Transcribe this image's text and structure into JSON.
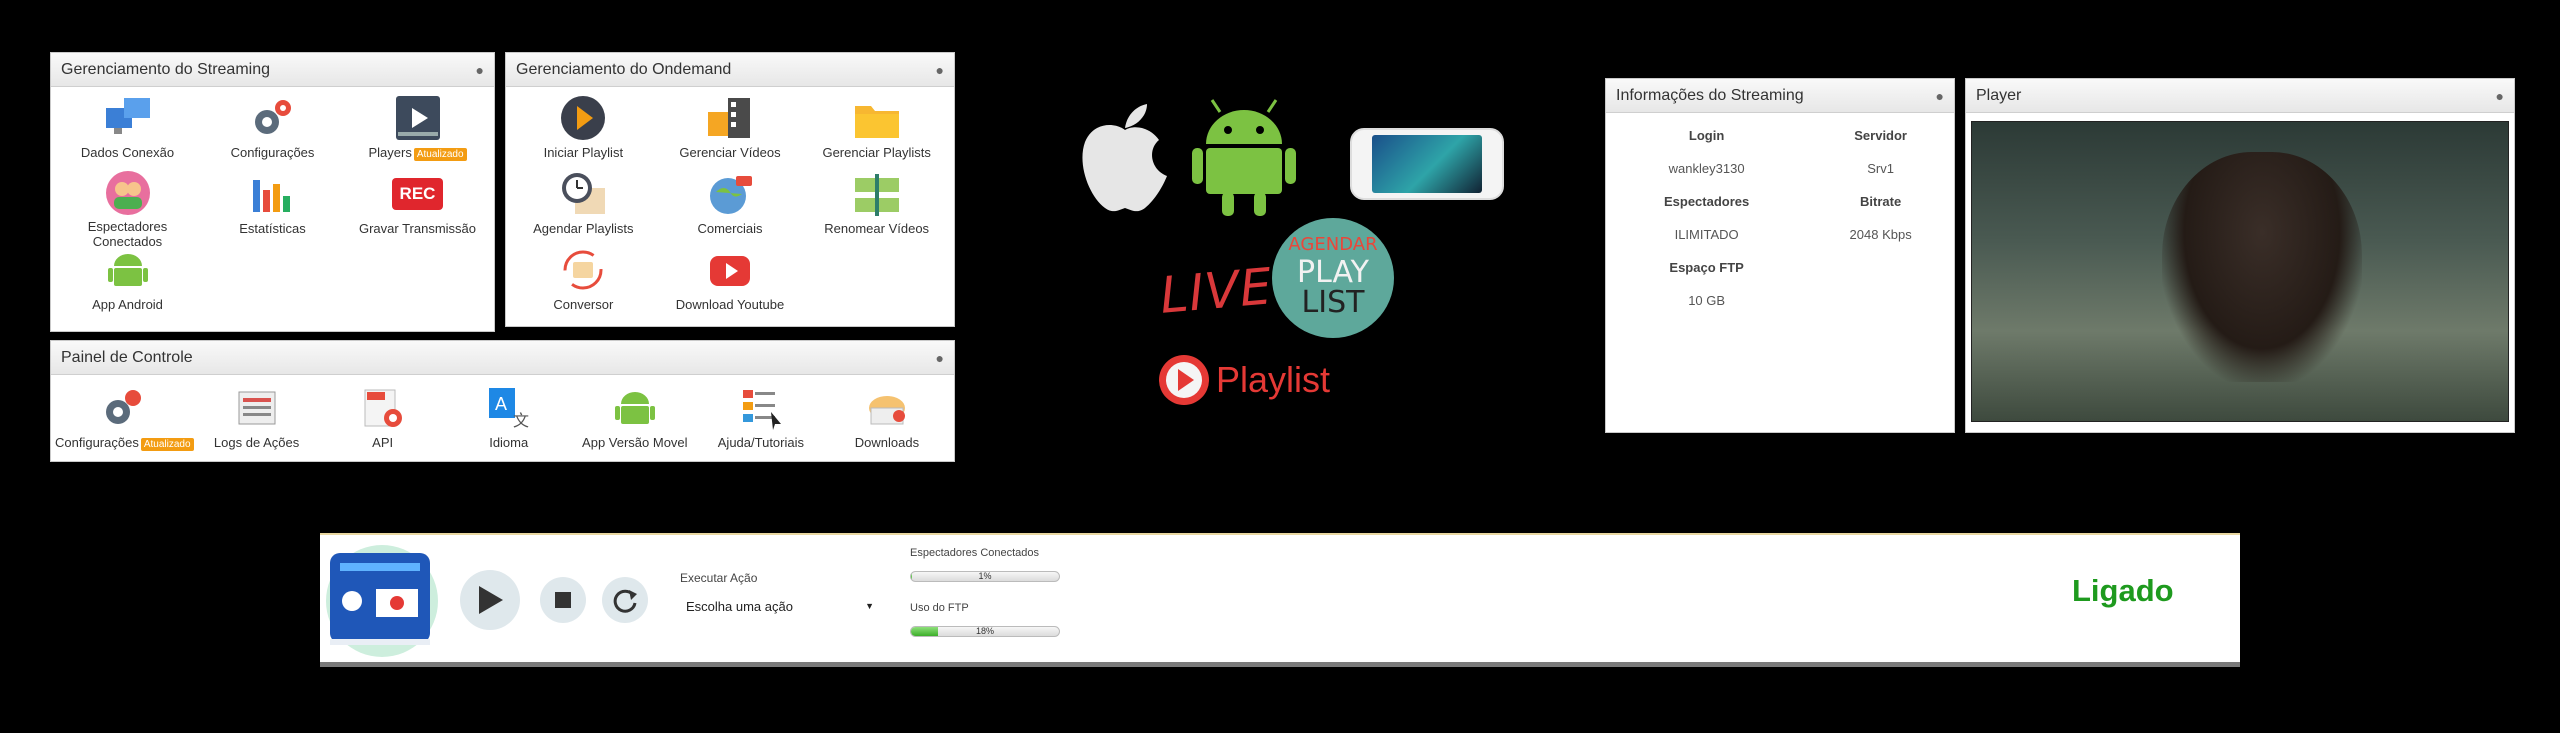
{
  "streaming": {
    "title": "Gerenciamento do Streaming",
    "items": [
      {
        "label": "Dados Conexão"
      },
      {
        "label": "Configurações"
      },
      {
        "label": "Players",
        "badge": "Atualizado"
      },
      {
        "label": "Espectadores Conectados"
      },
      {
        "label": "Estatísticas"
      },
      {
        "label": "Gravar Transmissão"
      },
      {
        "label": "App Android"
      }
    ]
  },
  "ondemand": {
    "title": "Gerenciamento do Ondemand",
    "items": [
      {
        "label": "Iniciar Playlist"
      },
      {
        "label": "Gerenciar Vídeos"
      },
      {
        "label": "Gerenciar Playlists"
      },
      {
        "label": "Agendar Playlists"
      },
      {
        "label": "Comerciais"
      },
      {
        "label": "Renomear Vídeos"
      },
      {
        "label": "Conversor"
      },
      {
        "label": "Download Youtube"
      }
    ]
  },
  "painel": {
    "title": "Painel de Controle",
    "items": [
      {
        "label": "Configurações",
        "badge": "Atualizado"
      },
      {
        "label": "Logs de Ações"
      },
      {
        "label": "API"
      },
      {
        "label": "Idioma"
      },
      {
        "label": "App Versão Movel"
      },
      {
        "label": "Ajuda/Tutoriais"
      },
      {
        "label": "Downloads"
      }
    ]
  },
  "promo": {
    "live": "LIVE",
    "agendar": "AGENDAR",
    "play": "PLAY",
    "list": "LIST",
    "playlist": "Playlist",
    "rec": "REC"
  },
  "info": {
    "title": "Informações do Streaming",
    "login_label": "Login",
    "login": "wankley3130",
    "servidor_label": "Servidor",
    "servidor": "Srv1",
    "espectadores_label": "Espectadores",
    "espectadores": "ILIMITADO",
    "bitrate_label": "Bitrate",
    "bitrate": "2048 Kbps",
    "ftp_label": "Espaço FTP",
    "ftp": "10 GB"
  },
  "player": {
    "title": "Player"
  },
  "control": {
    "action_label": "Executar Ação",
    "action_value": "Escolha uma ação",
    "viewers_label": "Espectadores Conectados",
    "viewers_pct_text": "1%",
    "viewers_pct": 1,
    "ftp_label": "Uso do FTP",
    "ftp_pct_text": "18%",
    "ftp_pct": 18,
    "status": "Ligado"
  },
  "colors": {
    "status": "#1e9a1e",
    "badge": "#f39c12",
    "live": "#d9383a",
    "teal": "#5ea89b"
  }
}
